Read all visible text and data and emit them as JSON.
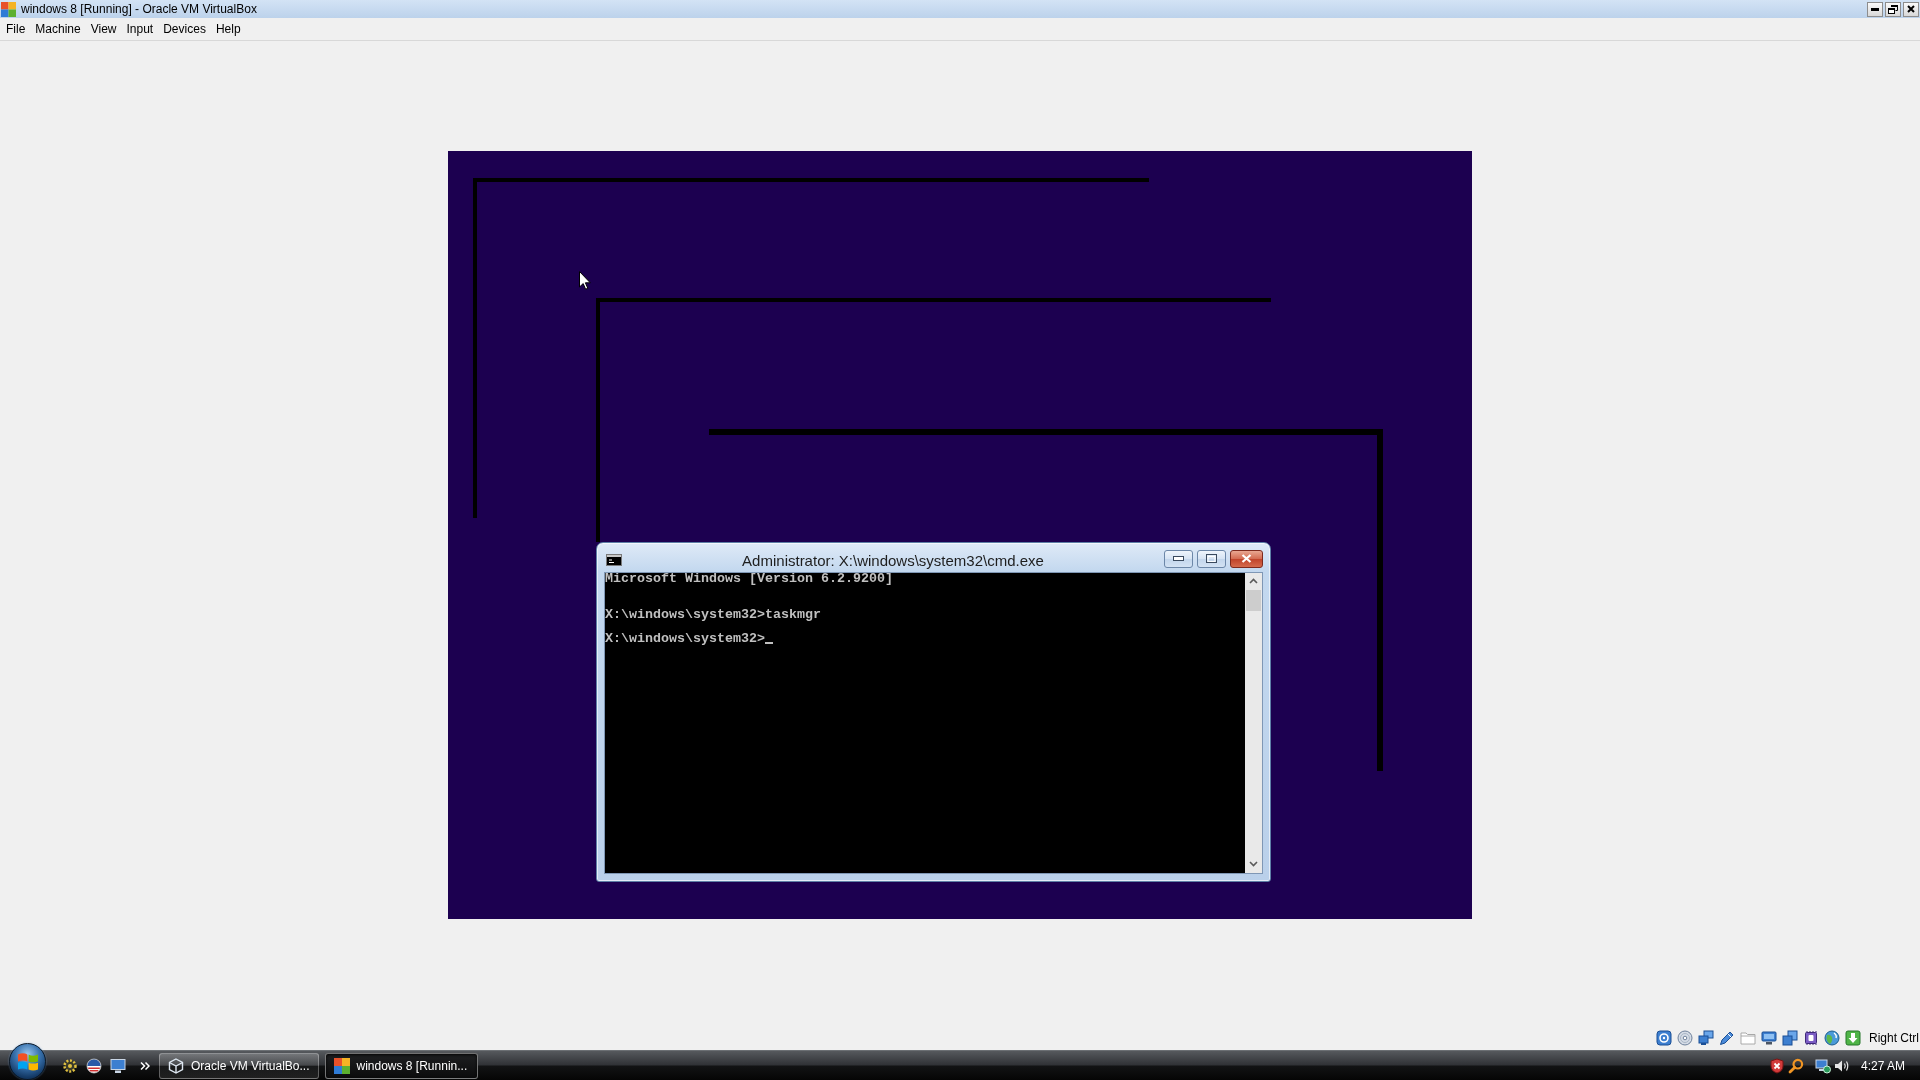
{
  "window": {
    "title": "windows 8 [Running] - Oracle VM VirtualBox"
  },
  "menu": [
    {
      "label": "File"
    },
    {
      "label": "Machine"
    },
    {
      "label": "View"
    },
    {
      "label": "Input"
    },
    {
      "label": "Devices"
    },
    {
      "label": "Help"
    }
  ],
  "vm_display": {
    "console_window": {
      "title": "Administrator: X:\\windows\\system32\\cmd.exe",
      "lines": [
        {
          "text": "Microsoft Windows [Version 6.2.9200]",
          "cursor": false
        },
        {
          "text": "X:\\windows\\system32>taskmgr",
          "cursor": false
        },
        {
          "text": "X:\\windows\\system32>",
          "cursor": true
        }
      ]
    }
  },
  "status_bar": {
    "indicators": [
      {
        "kind": "disk",
        "disabled": false
      },
      {
        "kind": "optical",
        "disabled": false
      },
      {
        "kind": "network",
        "disabled": false
      },
      {
        "kind": "usb",
        "disabled": false
      },
      {
        "kind": "folders",
        "disabled": true
      },
      {
        "kind": "display",
        "disabled": false
      },
      {
        "kind": "seamless",
        "disabled": false
      },
      {
        "kind": "cpu",
        "disabled": false
      },
      {
        "kind": "mouse",
        "disabled": false
      },
      {
        "kind": "keyboard",
        "disabled": false
      }
    ],
    "host_key": "Right Ctrl"
  },
  "taskbar": {
    "tasks": [
      {
        "kind": "manager",
        "label": "Oracle VM VirtualBo...",
        "selected": false
      },
      {
        "kind": "machine",
        "label": "windows 8 [Runnin...",
        "selected": true
      }
    ],
    "clock": "4:27 AM"
  }
}
